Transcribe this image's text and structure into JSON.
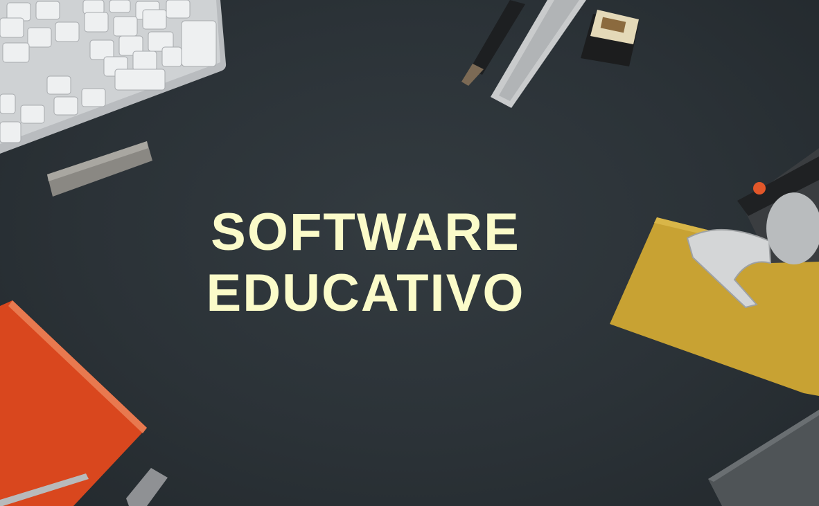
{
  "headline": {
    "line1": "SOFTWARE",
    "line2": "EDUCATIVO",
    "color": "#fbfbc9"
  },
  "background": {
    "color": "#2b3237"
  },
  "props": {
    "keyboard": "keyboard",
    "usb_drive": "usb-drive",
    "pen": "pen",
    "utility_knife": "utility-knife",
    "eraser": "eraser",
    "stapler": "stapler",
    "yellow_notebook": "yellow-notebook",
    "red_notebook": "red-notebook",
    "ballpoint_pen": "ballpoint-pen",
    "laptop_corner": "laptop-corner"
  }
}
